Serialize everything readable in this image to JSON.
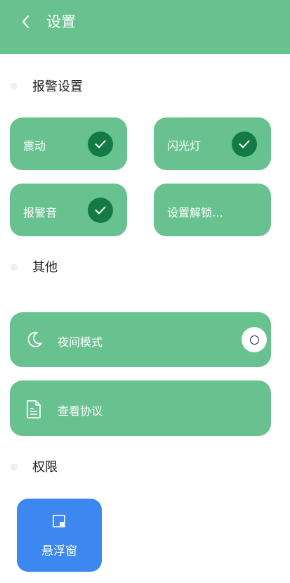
{
  "header": {
    "title": "设置",
    "back_icon": "chevron-left-icon"
  },
  "colors": {
    "primary_green": "#67c28f",
    "check_green": "#137a45",
    "float_blue": "#3c87f0"
  },
  "alarm_section": {
    "title": "报警设置",
    "items": [
      {
        "label": "震动",
        "checked": true
      },
      {
        "label": "闪光灯",
        "checked": true
      },
      {
        "label": "报警音",
        "checked": true
      },
      {
        "label": "设置解锁…",
        "checked": false
      }
    ]
  },
  "other_section": {
    "title": "其他",
    "night_mode": {
      "label": "夜间模式",
      "icon": "moon-icon",
      "enabled": false
    },
    "agreement": {
      "label": "查看协议",
      "icon": "document-icon"
    }
  },
  "permission_section": {
    "title": "权限",
    "floating_window": {
      "label": "悬浮窗",
      "icon": "floating-window-icon"
    }
  }
}
